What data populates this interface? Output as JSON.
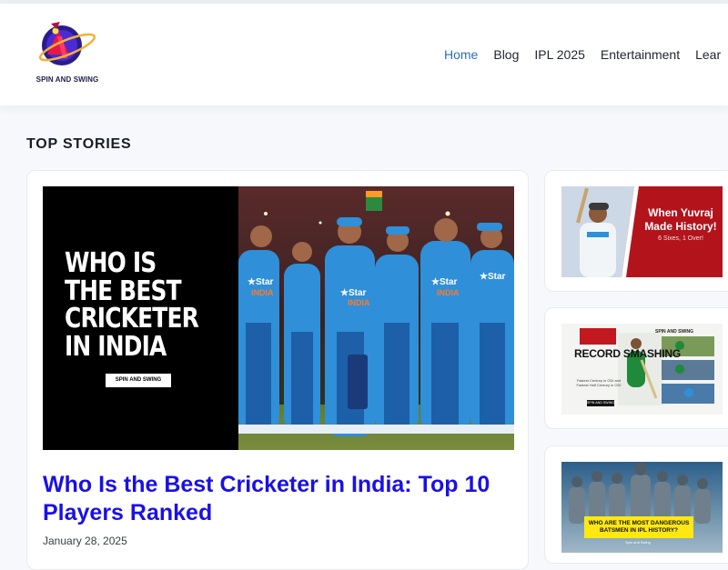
{
  "site": {
    "logo_text": "SPIN AND SWING"
  },
  "nav": {
    "items": [
      {
        "label": "Home",
        "active": true
      },
      {
        "label": "Blog",
        "active": false
      },
      {
        "label": "IPL 2025",
        "active": false
      },
      {
        "label": "Entertainment",
        "active": false
      },
      {
        "label": "Lear",
        "active": false
      }
    ]
  },
  "section": {
    "title": "TOP STORIES"
  },
  "featured": {
    "image_headline": "WHO IS THE BEST CRICKETER IN INDIA",
    "image_badge": "SPIN AND SWING",
    "title": "Who Is the Best Cricketer in India: Top 10 Players Ranked",
    "date": "January 28, 2025"
  },
  "side_stories": [
    {
      "headline": "When Yuvraj Made History!",
      "subtext": "6 Sixes, 1 Over!"
    },
    {
      "headline": "RECORD SMASHING",
      "subtext": "Fastest Century in ODI and Fastest Half Century in ODI",
      "brand": "SPIN AND SWING",
      "badge": "SPIN AND SWING"
    },
    {
      "headline": "WHO ARE THE MOST DANGEROUS BATSMEN IN IPL HISTORY?",
      "brand": "Spin and Swing"
    }
  ],
  "colors": {
    "link": "#1a10e6",
    "nav_active": "#2a6ebf",
    "team_blue": "#2f8fd8",
    "card_border": "#e8eaf0"
  }
}
